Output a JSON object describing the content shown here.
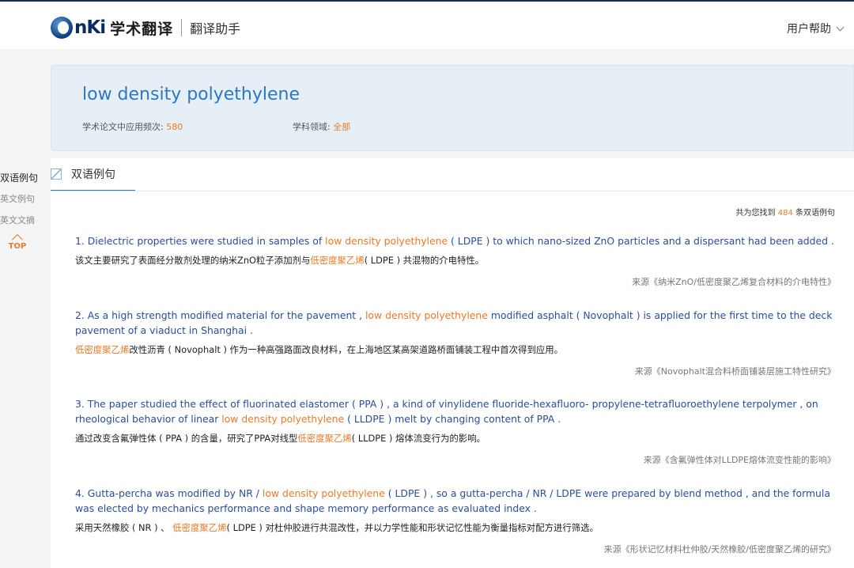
{
  "header": {
    "logo_mark": "nKi",
    "logo_text": "学术翻译",
    "logo_sub": "翻译助手",
    "help_label": "用户帮助"
  },
  "term": {
    "title": "low density polyethylene",
    "freq_label": "学术论文中应用频次: ",
    "freq_value": "580",
    "field_label": "学科领域: ",
    "field_value": "全部"
  },
  "sidenav": {
    "items": [
      "双语例句",
      "英文例句",
      "英文文摘"
    ],
    "top_label": "TOP"
  },
  "tab": {
    "label": "双语例句"
  },
  "count": {
    "prefix": "共为您找到 ",
    "value": "484",
    "suffix": " 条双语例句"
  },
  "examples": [
    {
      "en_before": "1. Dielectric properties were studied in samples of ",
      "en_hl": "low density polyethylene",
      "en_after": " ( LDPE ) to which nano-sized ZnO particles and a dispersant had been added .",
      "zh_before": "该文主要研究了表面经分散剂处理的纳米ZnO粒子添加剂与",
      "zh_hl": "低密度聚乙烯",
      "zh_after": "( LDPE ) 共混物的介电特性。",
      "source": "来源《纳米ZnO/低密度聚乙烯复合材料的介电特性》"
    },
    {
      "en_before": "2. As a high strength modified material for the pavement , ",
      "en_hl": "low density polyethylene",
      "en_after": " modified asphalt ( Novophalt ) is applied for the first time to the deck pavement of a viaduct in Shanghai .",
      "zh_before": "",
      "zh_hl": "低密度聚乙烯",
      "zh_after": "改性沥青 ( Novophalt ) 作为一种高强路面改良材料，在上海地区某高架道路桥面铺装工程中首次得到应用。",
      "source": "来源《Novophalt混合料桥面铺装层施工特性研究》"
    },
    {
      "en_before": "3. The paper studied the effect of fluorinated elastomer ( PPA ) , a kind of vinylidene fluoride-hexafluoro- propylene-tetrafluoroethylene terpolymer , on rheological behavior of linear ",
      "en_hl": "low density polyethylene",
      "en_after": " ( LLDPE ) melt by changing content of PPA .",
      "zh_before": "通过改变含氟弹性体 ( PPA ) 的含量，研究了PPA对线型",
      "zh_hl": "低密度聚乙烯",
      "zh_after": "( LLDPE ) 熔体流变行为的影响。",
      "source": "来源《含氟弹性体对LLDPE熔体流变性能的影响》"
    },
    {
      "en_before": "4. Gutta-percha was modified by NR / ",
      "en_hl": "low density polyethylene",
      "en_after": " ( LDPE ) , so a gutta-percha / NR / LDPE were prepared by blend method , and the formula was elected by mechanics performance and shape memory performance as evaluated index .",
      "zh_before": "采用天然橡胶 ( NR ) 、 ",
      "zh_hl": "低密度聚乙烯",
      "zh_after": "( LDPE ) 对杜仲胶进行共混改性，并以力学性能和形状记忆性能为衡量指标对配方进行筛选。",
      "source": "来源《形状记忆材料杜仲胶/天然橡胶/低密度聚乙烯的研究》"
    }
  ],
  "colors": {
    "accent_blue": "#2b78c5",
    "highlight_orange": "#f07a2a",
    "example_blue": "#2a4e9a"
  }
}
